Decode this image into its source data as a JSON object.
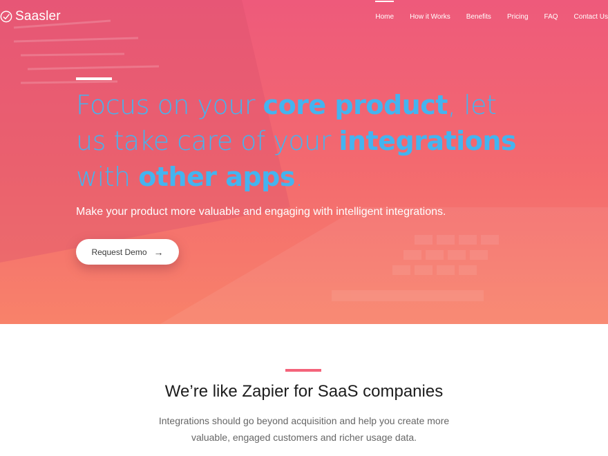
{
  "brand": {
    "name": "Saasler"
  },
  "nav": {
    "items": [
      "Home",
      "How it Works",
      "Benefits",
      "Pricing",
      "FAQ",
      "Contact Us"
    ],
    "active": "Home"
  },
  "hero": {
    "headline": [
      {
        "text": "Focus on your ",
        "bold": false
      },
      {
        "text": "core product",
        "bold": true
      },
      {
        "text": ", let us take care of your ",
        "bold": false
      },
      {
        "text": "integrations",
        "bold": true
      },
      {
        "text": " with ",
        "bold": false
      },
      {
        "text": "other apps",
        "bold": true
      },
      {
        "text": ".",
        "bold": false
      }
    ],
    "subtitle": "Make your product more valuable and engaging with intelligent integrations.",
    "cta_label": "Request Demo",
    "headline_color": "#44b4ef",
    "overlay_color": "#f46d72"
  },
  "about": {
    "title": "We’re like Zapier for SaaS companies",
    "text": "Integrations should go beyond acquisition and help you create more valuable, engaged customers and richer usage data.",
    "accent": "#f4637a"
  },
  "icons": {
    "logo": "check-circle-icon",
    "cta_arrow": "arrow-right-icon"
  }
}
